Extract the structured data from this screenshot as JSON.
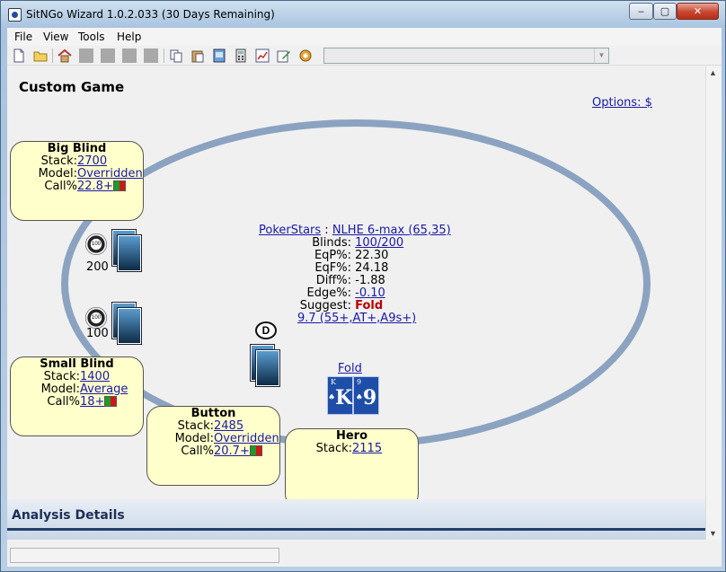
{
  "window": {
    "title": "SitNGo Wizard 1.0.2.033 (30 Days Remaining)",
    "minimize": "‒",
    "maximize": "▢",
    "close": "✕"
  },
  "menu": [
    "File",
    "View",
    "Tools",
    "Help"
  ],
  "toolbar": {
    "icons": [
      "new-file-icon",
      "open-folder-icon",
      "home-icon",
      "disabled-icon",
      "disabled-icon",
      "disabled-icon",
      "disabled-icon",
      "copy-icon",
      "paste-icon",
      "screenshot-icon",
      "calculator-icon",
      "chart-icon",
      "edit-icon",
      "settings-icon"
    ],
    "combo_value": ""
  },
  "page": {
    "title": "Custom Game",
    "options_link": "Options: $"
  },
  "seats": {
    "big_blind": {
      "name": "Big Blind",
      "stack_label": "Stack:",
      "stack": "2700",
      "model_label": "Model:",
      "model": "Overridden",
      "call_label": "Call%",
      "call": "22.8+",
      "bet": "200"
    },
    "small_blind": {
      "name": "Small Blind",
      "stack_label": "Stack:",
      "stack": "1400",
      "model_label": "Model:",
      "model": "Average",
      "call_label": "Call%",
      "call": "18+",
      "bet": "100"
    },
    "button": {
      "name": "Button",
      "stack_label": "Stack:",
      "stack": "2485",
      "model_label": "Model:",
      "model": "Overridden",
      "call_label": "Call%",
      "call": "20.7+",
      "dealer_chip": "D"
    },
    "hero": {
      "name": "Hero",
      "stack_label": "Stack:",
      "stack": "2115",
      "action_link": "Fold",
      "cards": [
        {
          "rank": "K",
          "suit": "♠",
          "corner": "K"
        },
        {
          "rank": "9",
          "suit": "♠",
          "corner": "9"
        }
      ]
    }
  },
  "chip_label": "100",
  "center": {
    "site": "PokerStars",
    "separator": " : ",
    "game": "NLHE 6-max (65,35)",
    "blinds_label": "Blinds:",
    "blinds": "100/200",
    "eqp_label": "EqP%:",
    "eqp": "22.30",
    "eqf_label": "EqF%:",
    "eqf": "24.18",
    "diff_label": "Diff%:",
    "diff": "-1.88",
    "edge_label": "Edge%:",
    "edge": "-0.10",
    "suggest_label": "Suggest:",
    "suggest": "Fold",
    "range_link": "9.7 (55+,AT+,A9s+)"
  },
  "analysis": {
    "title": "Analysis Details"
  },
  "colors": {
    "seat_fill": "#ffffcb",
    "table_rail": "#8ba3c0",
    "link": "#1a1aa6",
    "fold": "#bb0000"
  }
}
